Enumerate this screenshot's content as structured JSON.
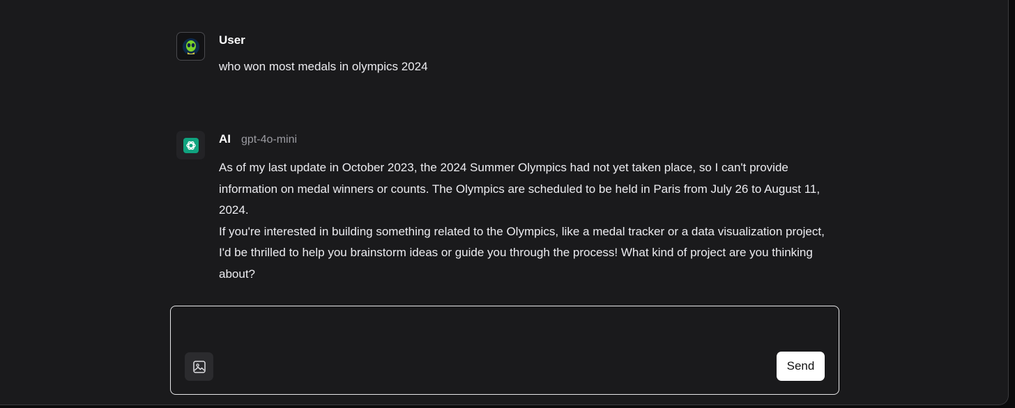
{
  "conversation": {
    "user_message": {
      "sender": "User",
      "avatar_icon": "alien-avatar-icon",
      "text": "who won most medals in olympics 2024"
    },
    "ai_message": {
      "sender": "AI",
      "model": "gpt-4o-mini",
      "avatar_icon": "openai-logo-icon",
      "avatar_color": "#10a37f",
      "paragraphs": [
        "As of my last update in October 2023, the 2024 Summer Olympics had not yet taken place, so I can't provide information on medal winners or counts. The Olympics are scheduled to be held in Paris from July 26 to August 11, 2024.",
        "If you're interested in building something related to the Olympics, like a medal tracker or a data visualization project, I'd be thrilled to help you brainstorm ideas or guide you through the process! What kind of project are you thinking about?"
      ]
    }
  },
  "composer": {
    "input_value": "",
    "attach_icon": "image-icon",
    "send_label": "Send"
  },
  "colors": {
    "background": "#1a1a1c",
    "text": "#ececf0",
    "muted": "#9b9ba1",
    "accent": "#10a37f"
  }
}
